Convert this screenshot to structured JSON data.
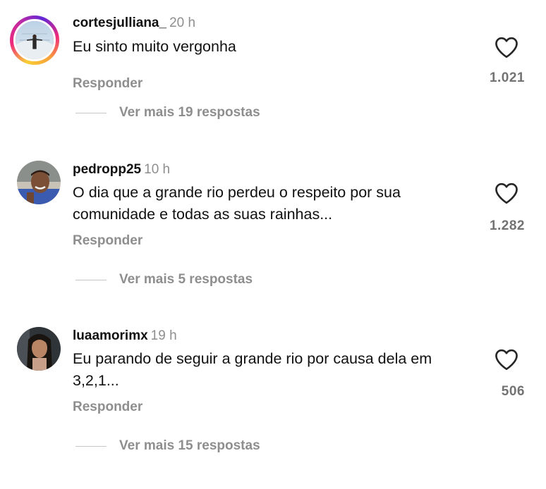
{
  "comments": [
    {
      "username": "cortesjulliana_",
      "time": "20 h",
      "text": "Eu sinto muito vergonha",
      "reply_label": "Responder",
      "likes": "1.021",
      "more_replies": "Ver mais 19 respostas",
      "has_story_ring": true
    },
    {
      "username": "pedropp25",
      "time": "10 h",
      "text": "O dia que a grande rio perdeu o respeito por sua comunidade e todas as suas rainhas...",
      "reply_label": "Responder",
      "likes": "1.282",
      "more_replies": "Ver mais 5 respostas",
      "has_story_ring": false
    },
    {
      "username": "luaamorimx",
      "time": "19 h",
      "text": "Eu parando de seguir a grande rio por causa dela em 3,2,1...",
      "reply_label": "Responder",
      "likes": "506",
      "more_replies": "Ver mais 15 respostas",
      "has_story_ring": false
    }
  ],
  "icons": {
    "like": "heart-outline-icon"
  },
  "colors": {
    "secondary_text": "#8e8e8e",
    "like_count": "#737373",
    "story_ring": [
      "#f9ce34",
      "#ee2a7b",
      "#6228d7"
    ]
  }
}
